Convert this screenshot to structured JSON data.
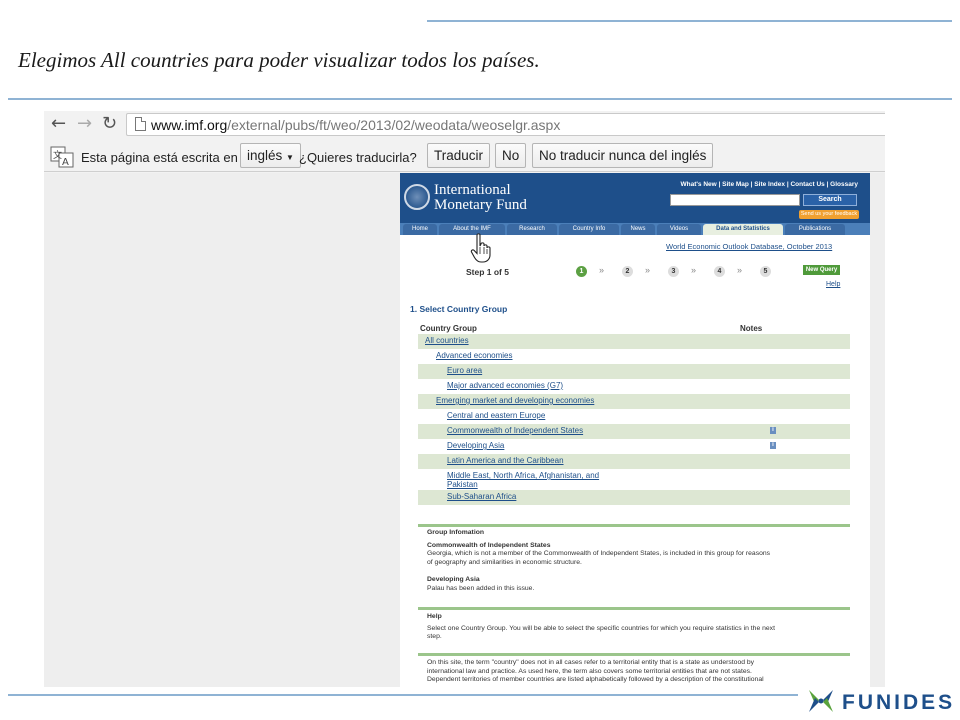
{
  "slide": {
    "title": "Elegimos All countries para poder visualizar todos los países."
  },
  "browser": {
    "back_icon": "arrow-left-icon",
    "forward_icon": "arrow-right-icon",
    "reload_icon": "reload-icon",
    "url_host": "www.imf.org",
    "url_path": "/external/pubs/ft/weo/2013/02/weodata/weoselgr.aspx",
    "translate": {
      "prefix": "Esta página está escrita en",
      "language": "inglés",
      "question": "¿Quieres traducirla?",
      "translate_button": "Traducir",
      "no_button": "No",
      "never_button": "No traducir nunca del inglés"
    }
  },
  "imf": {
    "name_line1": "International",
    "name_line2": "Monetary Fund",
    "top_links": "What's New  |  Site Map  |  Site Index  |  Contact Us  |  Glossary",
    "search_button": "Search",
    "feedback": "Send us your feedback",
    "nav_tabs": [
      {
        "label": "Home"
      },
      {
        "label": "About the IMF"
      },
      {
        "label": "Research"
      },
      {
        "label": "Country Info"
      },
      {
        "label": "News"
      },
      {
        "label": "Videos"
      },
      {
        "label": "Data and Statistics"
      },
      {
        "label": "Publications"
      }
    ],
    "weo_link": "World Economic Outlook Database, October 2013",
    "step_label": "Step 1 of 5",
    "steps": [
      "1",
      "2",
      "3",
      "4",
      "5"
    ],
    "new_query": "New Query",
    "help": "Help",
    "section_title": "1. Select Country Group",
    "col_group": "Country Group",
    "col_notes": "Notes",
    "groups": [
      {
        "label": "All countries"
      },
      {
        "label": "Advanced economies"
      },
      {
        "label": "Euro area"
      },
      {
        "label": "Major advanced economies (G7)"
      },
      {
        "label": "Emerging market and developing economies"
      },
      {
        "label": "Central and eastern Europe"
      },
      {
        "label": "Commonwealth of Independent States"
      },
      {
        "label": "Developing Asia"
      },
      {
        "label": "Latin America and the Caribbean"
      },
      {
        "label": "Middle East, North Africa, Afghanistan, and"
      },
      {
        "label": "Pakistan"
      },
      {
        "label": "Sub-Saharan Africa"
      }
    ],
    "group_info": {
      "heading": "Group Infomation",
      "cis_title": "Commonwealth of Independent States",
      "cis_text_1": "Georgia, which is not a member of the Commonwealth of Independent States, is included in this group for reasons",
      "cis_text_2": "of geography and similarities in economic structure.",
      "asia_title": "Developing Asia",
      "asia_text": "Palau has been added in this issue."
    },
    "help_block": {
      "heading": "Help",
      "text_1": "Select one Country Group. You will be able to select the specific countries for which you require statistics in the next",
      "text_2": "step."
    },
    "footer_note": {
      "line_1": "On this site, the term \"country\" does not in all cases refer to a territorial entity that is a state as understood by",
      "line_2": "international law and practice. As used here, the term also covers some territorial entities that are not states.",
      "line_3": "Dependent territories of member countries are listed alphabetically followed by a description of the constitutional"
    }
  },
  "logo": {
    "text": "FUNIDES"
  }
}
